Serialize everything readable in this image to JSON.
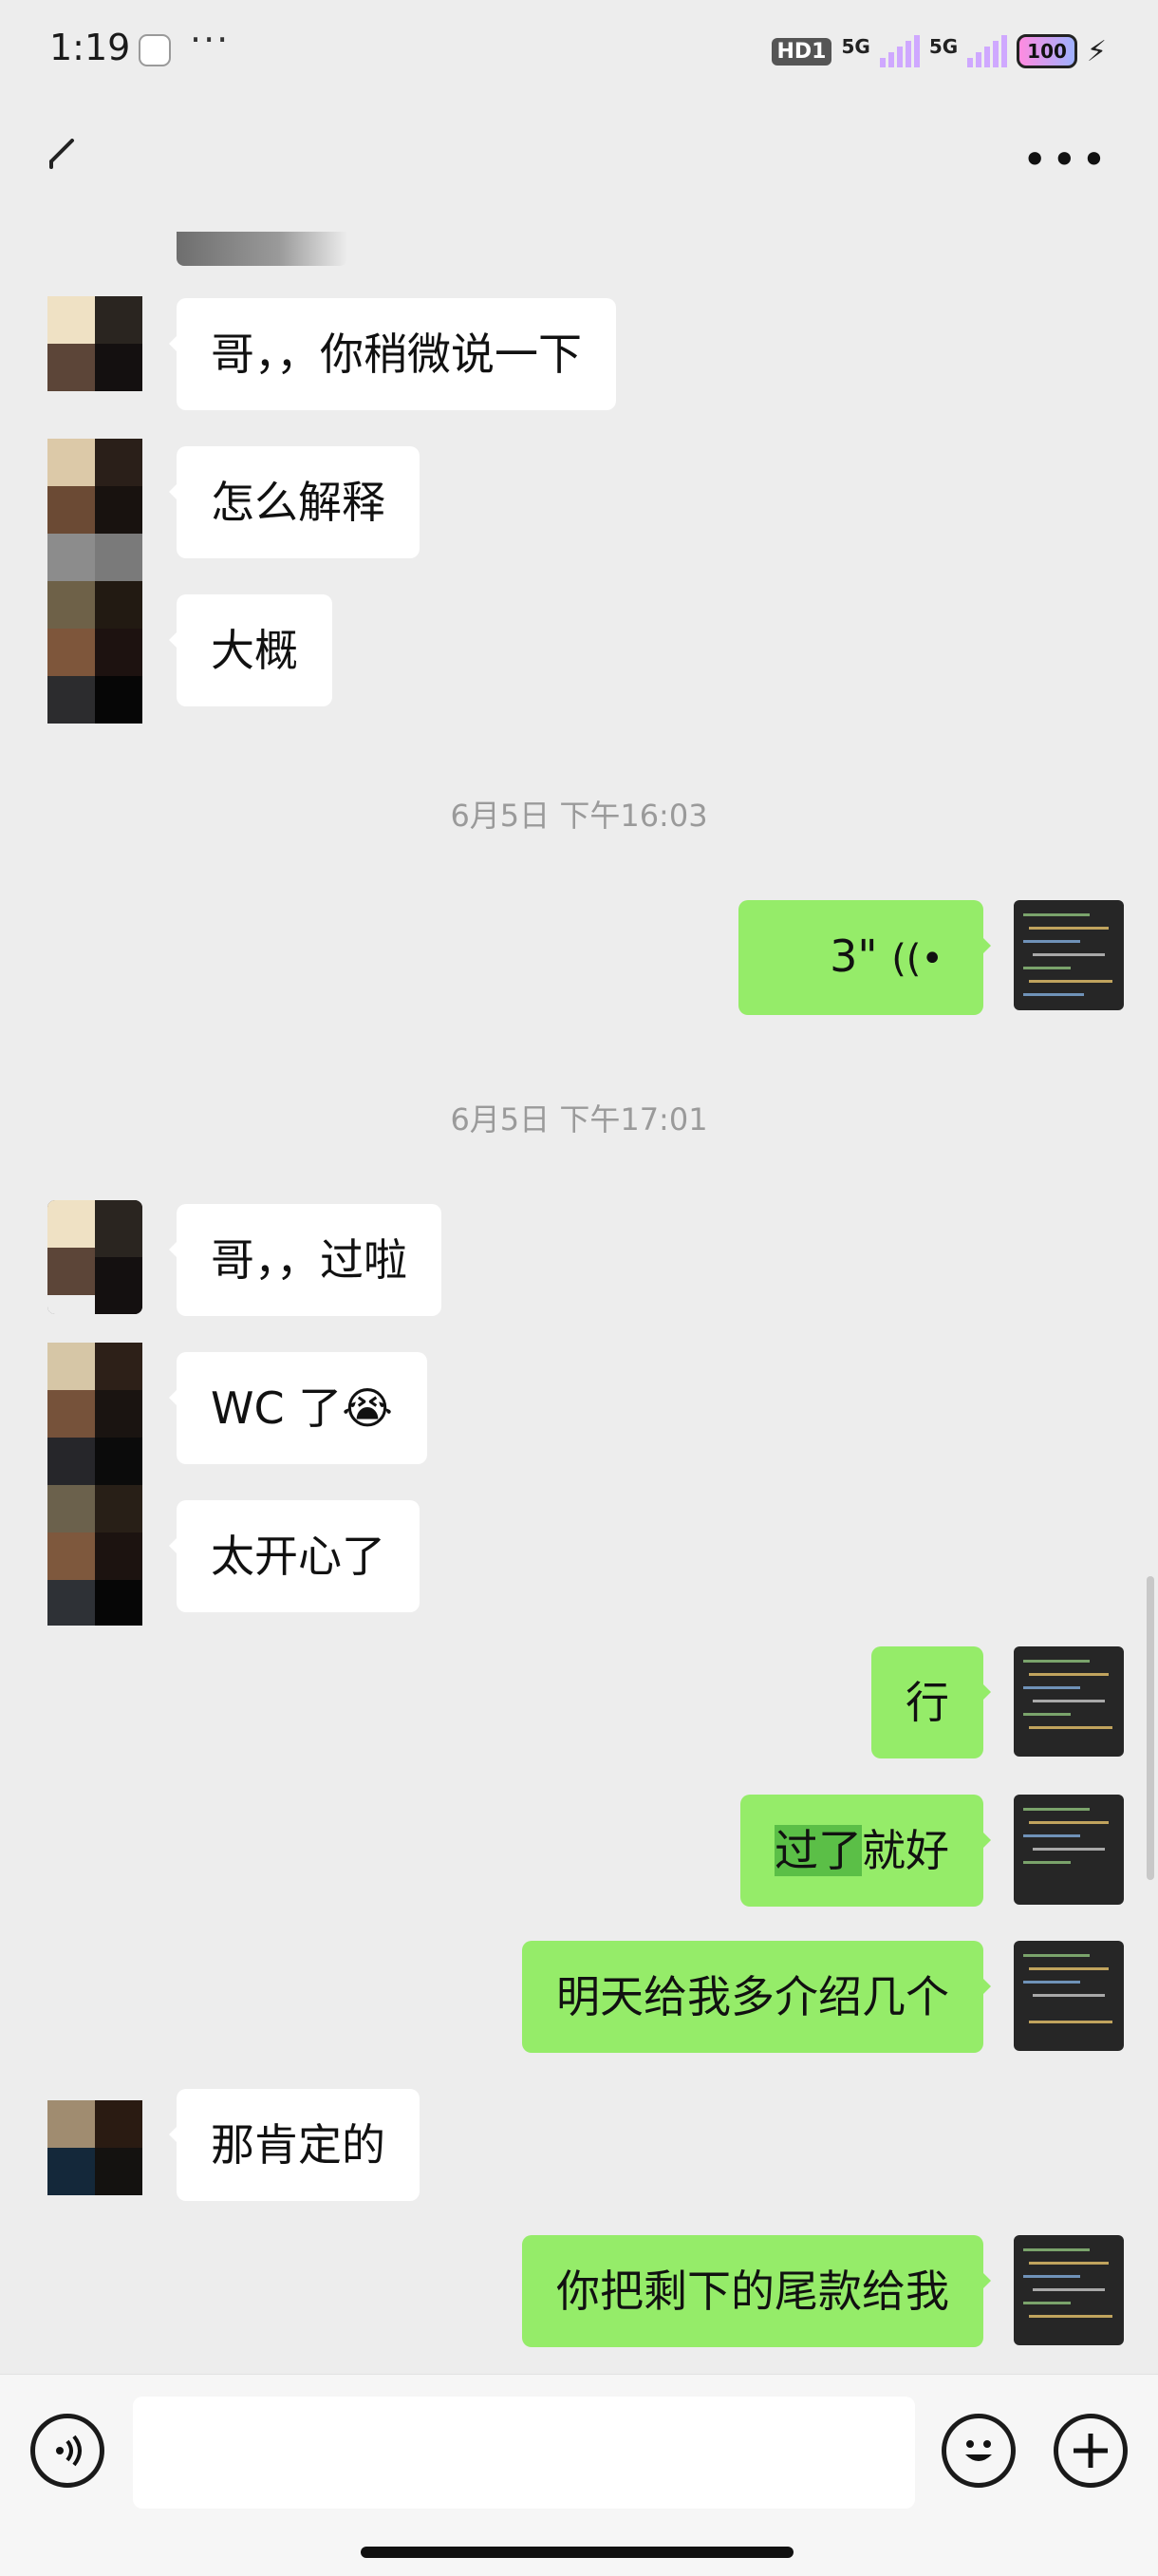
{
  "status_bar": {
    "time": "1:19",
    "more": "···",
    "hd_label": "HD1",
    "net1": "5G",
    "net2": "5G",
    "battery": "100"
  },
  "messages": [
    {
      "side": "in",
      "text": "哥，，你稍微说一下"
    },
    {
      "side": "in",
      "text": "怎么解释"
    },
    {
      "side": "in",
      "text": "大概"
    },
    {
      "type": "time",
      "text": "6月5日 下午16:03"
    },
    {
      "side": "out",
      "type": "voice",
      "text": "3\""
    },
    {
      "type": "time",
      "text": "6月5日 下午17:01"
    },
    {
      "side": "in",
      "text": "哥，，过啦"
    },
    {
      "side": "in",
      "text": "WC 了",
      "emoji": "😭"
    },
    {
      "side": "in",
      "text": "太开心了"
    },
    {
      "side": "out",
      "text": "行"
    },
    {
      "side": "out",
      "text_highlight": "过了",
      "text": "就好"
    },
    {
      "side": "out",
      "text": "明天给我多介绍几个"
    },
    {
      "side": "in",
      "text": "那肯定的"
    },
    {
      "side": "out",
      "text": "你把剩下的尾款给我"
    }
  ],
  "icons": {
    "back": "back-arrow-icon",
    "more": "more-icon",
    "voice_input": "voice-input-icon",
    "emoji": "emoji-icon",
    "plus": "plus-icon"
  }
}
